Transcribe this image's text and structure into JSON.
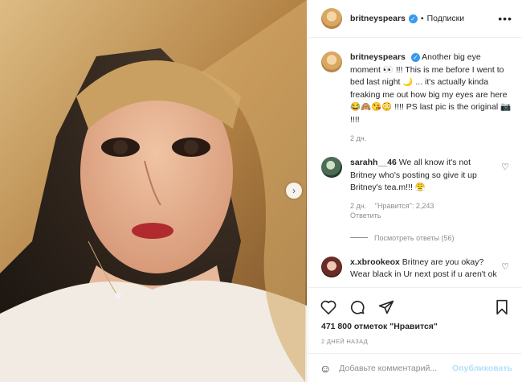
{
  "post": {
    "username": "britneyspears",
    "verified_icon": "verified-badge-icon",
    "separator": "•",
    "follow_label": "Подписки",
    "more_icon": "more-options-icon"
  },
  "caption": {
    "username": "britneyspears",
    "text": "Another big eye moment 👀 !!! This is me before I went to bed last night 🌙 ... it's actually kinda freaking me out how big my eyes are here 😂🙈😘😳 !!!! PS last pic is the original 📷 !!!!",
    "time": "2 дн."
  },
  "comments": [
    {
      "username": "sarahh__46",
      "text": "We all know it's not Britney who's posting so give it up Britney's tea.m!!! 😤",
      "time": "2 дн.",
      "likes": "\"Нравится\": 2,243",
      "reply_label": "Ответить",
      "view_replies": "Посмотреть ответы (56)"
    },
    {
      "username": "x.xbrookeox",
      "text": "Britney are you okay? Wear black in Ur next post if u aren't ok"
    }
  ],
  "actions": {
    "likes_text": "471 800 отметок \"Нравится\"",
    "date": "2 ДНЕЙ НАЗАД"
  },
  "add_comment": {
    "placeholder": "Добавьте комментарий...",
    "publish_label": "Опубликовать"
  },
  "colors": {
    "verified": "#3897f0",
    "publish_disabled": "#b2dffc",
    "muted": "#8e8e8e"
  }
}
